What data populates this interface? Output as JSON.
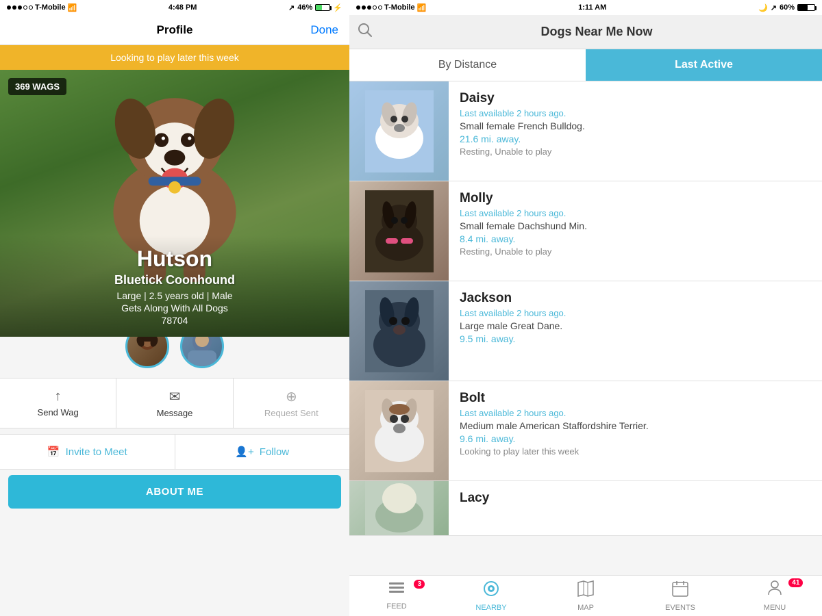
{
  "left": {
    "statusBar": {
      "carrier": "T-Mobile",
      "time": "4:48 PM",
      "battery": "46%",
      "signal": "●●●○○"
    },
    "nav": {
      "title": "Profile",
      "doneLabel": "Done"
    },
    "banner": "Looking to play later this week",
    "wags": "369 WAGS",
    "dog": {
      "name": "Hutson",
      "breed": "Bluetick Coonhound",
      "details": "Large  |  2.5 years old  |  Male",
      "compat": "Gets Along With All Dogs",
      "zip": "78704"
    },
    "actions": {
      "sendWag": "Send Wag",
      "message": "Message",
      "requestSent": "Request Sent"
    },
    "meetFollow": {
      "inviteLabel": "Invite to Meet",
      "followLabel": "Follow"
    },
    "aboutMe": "ABOUT ME"
  },
  "right": {
    "statusBar": {
      "carrier": "T-Mobile",
      "time": "1:11 AM",
      "battery": "60%"
    },
    "searchTitle": "Dogs Near Me Now",
    "tabs": {
      "byDistance": "By Distance",
      "lastActive": "Last Active"
    },
    "dogs": [
      {
        "name": "Daisy",
        "lastActive": "Last available 2 hours ago.",
        "description": "Small female French Bulldog.",
        "distance": "21.6 mi. away.",
        "status": "Resting, Unable to play",
        "bgClass": "daisy-bg",
        "emoji": "🐶"
      },
      {
        "name": "Molly",
        "lastActive": "Last available 2 hours ago.",
        "description": "Small female Dachshund Min.",
        "distance": "8.4 mi. away.",
        "status": "Resting, Unable to play",
        "bgClass": "molly-bg",
        "emoji": "🐕"
      },
      {
        "name": "Jackson",
        "lastActive": "Last available 2 hours ago.",
        "description": "Large male Great Dane.",
        "distance": "9.5 mi. away.",
        "status": "",
        "bgClass": "jackson-bg",
        "emoji": "🐾"
      },
      {
        "name": "Bolt",
        "lastActive": "Last available 2 hours ago.",
        "description": "Medium male American Staffordshire Terrier.",
        "distance": "9.6 mi. away.",
        "status": "Looking to play later this week",
        "bgClass": "bolt-bg",
        "emoji": "🦴"
      },
      {
        "name": "Lacy",
        "lastActive": "",
        "description": "",
        "distance": "",
        "status": "",
        "bgClass": "lacy-bg",
        "emoji": "🐩"
      }
    ],
    "bottomNav": [
      {
        "label": "FEED",
        "icon": "≡",
        "badge": "3",
        "active": false
      },
      {
        "label": "NEARBY",
        "icon": "◉",
        "badge": "",
        "active": true
      },
      {
        "label": "MAP",
        "icon": "⊞",
        "badge": "",
        "active": false
      },
      {
        "label": "EVENTS",
        "icon": "▦",
        "badge": "",
        "active": false
      },
      {
        "label": "MENU",
        "icon": "☰",
        "badge": "41",
        "active": false
      }
    ]
  }
}
